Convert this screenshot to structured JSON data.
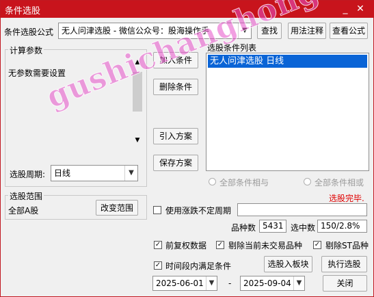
{
  "window": {
    "title": "条件选股",
    "minimize": "_",
    "close": "✕"
  },
  "formula": {
    "label": "条件选股公式",
    "value": "无人问津选股  -  微信公众号：股海操作手",
    "find": "查找",
    "usage": "用法注释",
    "view": "查看公式"
  },
  "params": {
    "group_label": "计算参数",
    "text": "无参数需要设置",
    "period_label": "选股周期:",
    "period_value": "日线"
  },
  "actions": {
    "add": "加入条件",
    "delete": "删除条件",
    "import": "引入方案",
    "save": "保存方案"
  },
  "conditions": {
    "label": "选股条件列表",
    "items": [
      "无人问津选股  日线"
    ],
    "all_and": "全部条件相与",
    "all_or": "全部条件相或",
    "status": "选股完毕.",
    "status_color": "#e00000"
  },
  "range": {
    "group_label": "选股范围",
    "value": "全部A股",
    "change": "改变范围"
  },
  "options": {
    "uncertain_period": "使用涨跌不定周期",
    "count_label": "品种数",
    "count_value": "5431",
    "selected_label": "选中数",
    "selected_value": "150/2.8%",
    "adjust": "前复权数据",
    "exclude_untraded": "剔除当前未交易品种",
    "exclude_st": "剔除ST品种",
    "time_condition": "时间段内满足条件",
    "to_block": "选股入板块",
    "execute": "执行选股",
    "date_from": "2025-06-01",
    "date_sep": "-",
    "date_to": "2025-09-04",
    "close": "关闭",
    "check_mark": "✓"
  },
  "watermark": "gushichanghong.com"
}
